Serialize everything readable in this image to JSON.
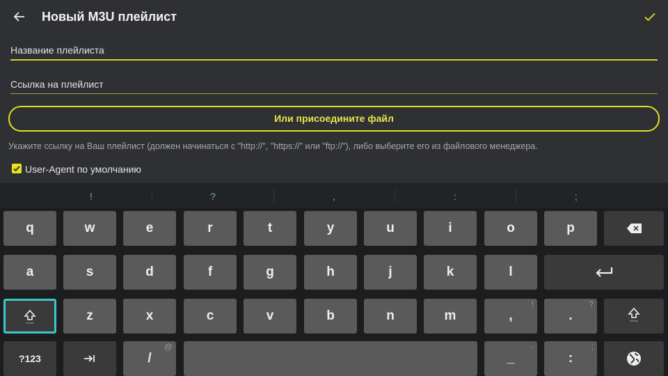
{
  "app": {
    "title": "Новый M3U плейлист",
    "playlist_name_placeholder": "Название плейлиста",
    "playlist_url_placeholder": "Ссылка на плейлист",
    "attach_button_label": "Или присоедините файл",
    "hint_text": "Укажите ссылку на Ваш плейлист (должен начинаться с \"http://\", \"https://\" или \"ftp://\"), либо выберите его из файлового менеджера.",
    "user_agent_checkbox": {
      "label": "User-Agent по умолчанию",
      "checked": true
    },
    "accent_color": "#e3df1c"
  },
  "keyboard": {
    "suggestions": [
      "!",
      "?",
      ",",
      ":",
      ";"
    ],
    "row1": [
      "q",
      "w",
      "e",
      "r",
      "t",
      "y",
      "u",
      "i",
      "o",
      "p"
    ],
    "row2": [
      "a",
      "s",
      "d",
      "f",
      "g",
      "h",
      "j",
      "k",
      "l"
    ],
    "row3": [
      "z",
      "x",
      "c",
      "v",
      "b",
      "n",
      "m",
      ",",
      "."
    ],
    "row3_hints": [
      "",
      "",
      "",
      "",
      "",
      "",
      "",
      "!",
      "?"
    ],
    "row4": {
      "symbols_label": "?123",
      "slash": "/",
      "slash_hint": "@",
      "underscore": "_",
      "underscore_hint": "-",
      "colon": ":",
      "colon_hint": ";"
    },
    "icons": [
      "backspace-icon",
      "enter-icon",
      "shift-icon",
      "tab-icon",
      "globe-icon",
      "back-arrow-icon",
      "checkmark-icon"
    ],
    "focus_color": "#3cc8c8"
  }
}
